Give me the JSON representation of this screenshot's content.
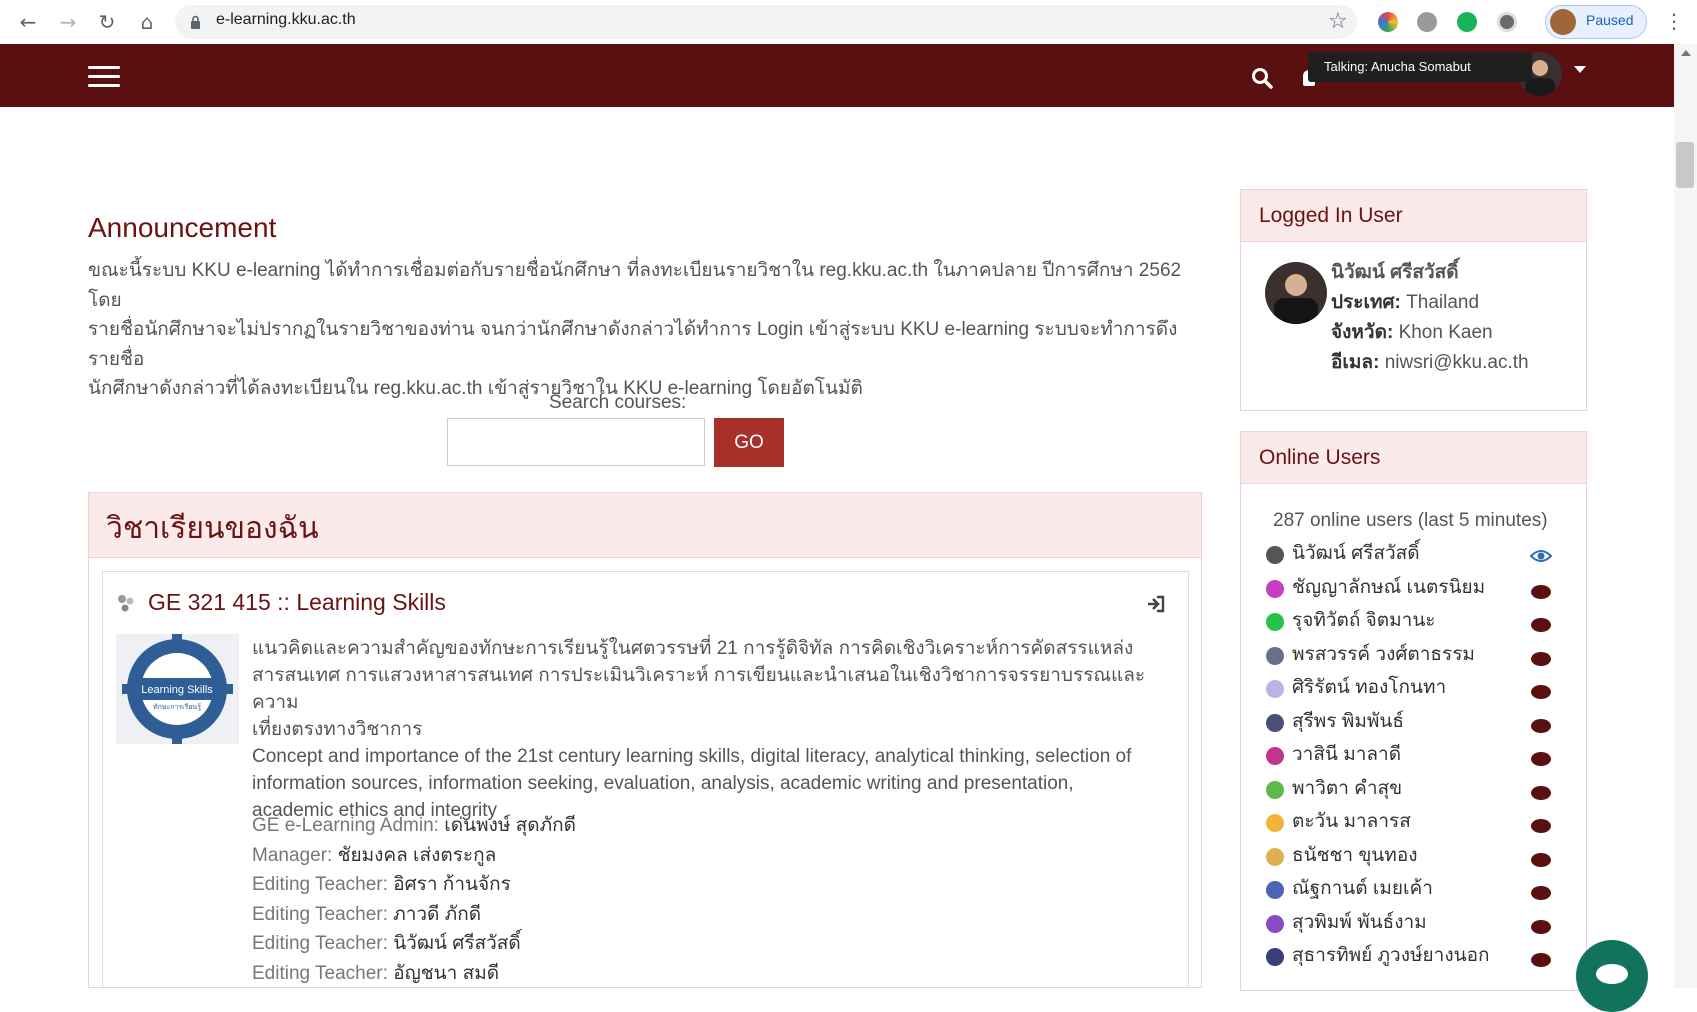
{
  "browser": {
    "url": "e-learning.kku.ac.th",
    "profile_label": "Paused"
  },
  "header": {
    "tooltip": "Talking: Anucha Somabut"
  },
  "announcement": {
    "title": "Announcement",
    "lines": [
      "ขณะนี้ระบบ KKU e-learning ได้ทำการเชื่อมต่อกับรายชื่อนักศึกษา ที่ลงทะเบียนรายวิชาใน reg.kku.ac.th ในภาคปลาย ปีการศึกษา 2562 โดย",
      "รายชื่อนักศึกษาจะไม่ปรากฏในรายวิชาของท่าน จนกว่านักศึกษาดังกล่าวได้ทำการ Login เข้าสู่ระบบ KKU e-learning ระบบจะทำการดึงรายชื่อ",
      "นักศึกษาดังกล่าวที่ได้ลงทะเบียนใน reg.kku.ac.th เข้าสู่รายวิชาใน KKU e-learning โดยอัตโนมัติ"
    ]
  },
  "search": {
    "label": "Search courses:",
    "value": "",
    "button": "GO"
  },
  "my_courses": {
    "title": "วิชาเรียนของฉัน",
    "course": {
      "title": "GE 321 415 :: Learning Skills",
      "image_text": "Learning Skills",
      "image_subtext": "ทักษะการเรียนรู้",
      "description_th": [
        "แนวคิดและความสำคัญของทักษะการเรียนรู้ในศตวรรษที่ 21 การรู้ดิจิทัล การคิดเชิงวิเคราะห์การคัดสรรแหล่ง",
        "สารสนเทศ การแสวงหาสารสนเทศ การประเมินวิเคราะห์ การเขียนและนำเสนอในเชิงวิชาการจรรยาบรรณและความ",
        "เที่ยงตรงทางวิชาการ"
      ],
      "description_en": [
        "Concept and importance of the 21st century learning skills, digital literacy, analytical thinking, selection of",
        "information sources, information seeking, evaluation, analysis, academic writing and presentation,",
        "academic ethics and integrity"
      ],
      "contacts": [
        {
          "role": "GE e-Learning Admin:",
          "name": "เด่นพงษ์ สุดภักดี"
        },
        {
          "role": "Manager:",
          "name": "ชัยมงคล เส่งตระกูล"
        },
        {
          "role": "Editing Teacher:",
          "name": "อิศรา ก้านจักร"
        },
        {
          "role": "Editing Teacher:",
          "name": "ภาวดี ภักดี"
        },
        {
          "role": "Editing Teacher:",
          "name": "นิวัฒน์ ศรีสวัสดิ์"
        },
        {
          "role": "Editing Teacher:",
          "name": "อัญชนา สมดี"
        }
      ]
    }
  },
  "logged_in_user": {
    "title": "Logged In User",
    "name": "นิวัฒน์ ศรีสวัสดิ์",
    "country_label": "ประเทศ:",
    "country": "Thailand",
    "province_label": "จังหวัด:",
    "province": "Khon Kaen",
    "email_label": "อีเมล:",
    "email": "niwsri@kku.ac.th"
  },
  "online_users": {
    "title": "Online Users",
    "summary": "287 online users (last 5 minutes)",
    "users": [
      {
        "name": "นิวัฒน์ ศรีสวัสดิ์",
        "icon_color": "#555555",
        "action": "eye"
      },
      {
        "name": "ชัญญาลักษณ์ เนตรนิยม",
        "icon_color": "#c63fc2",
        "action": "message"
      },
      {
        "name": "รุจทิวัตถ์ จิตมานะ",
        "icon_color": "#27c24a",
        "action": "message"
      },
      {
        "name": "พรสวรรค์ วงศ์ตาธรรม",
        "icon_color": "#6a6f8a",
        "action": "message"
      },
      {
        "name": "ศิริรัตน์ ทองโกนทา",
        "icon_color": "#b8b4e8",
        "action": "message"
      },
      {
        "name": "สุรีพร พิมพันธ์",
        "icon_color": "#4a4f7a",
        "action": "message"
      },
      {
        "name": "วาสินี มาลาดี",
        "icon_color": "#c2348e",
        "action": "message"
      },
      {
        "name": "พาวิตา คำสุข",
        "icon_color": "#5fb84a",
        "action": "message"
      },
      {
        "name": "ตะวัน มาลารส",
        "icon_color": "#f0b43a",
        "action": "message"
      },
      {
        "name": "ธนัชชา ขุนทอง",
        "icon_color": "#e0b050",
        "action": "message"
      },
      {
        "name": "ณัฐกานต์ เมยเค้า",
        "icon_color": "#4c64b4",
        "action": "message"
      },
      {
        "name": "สุวพิมพ์ พันธ์งาม",
        "icon_color": "#8a4cc4",
        "action": "message"
      },
      {
        "name": "สุธาร​ทิพย์ ภูวงษ์ยางนอก",
        "icon_color": "#3a3f7a",
        "action": "message"
      }
    ]
  },
  "colors": {
    "brand": "#5a1010",
    "button": "#a8302a",
    "block_bg": "#fbeaea",
    "chat": "#12735d"
  }
}
